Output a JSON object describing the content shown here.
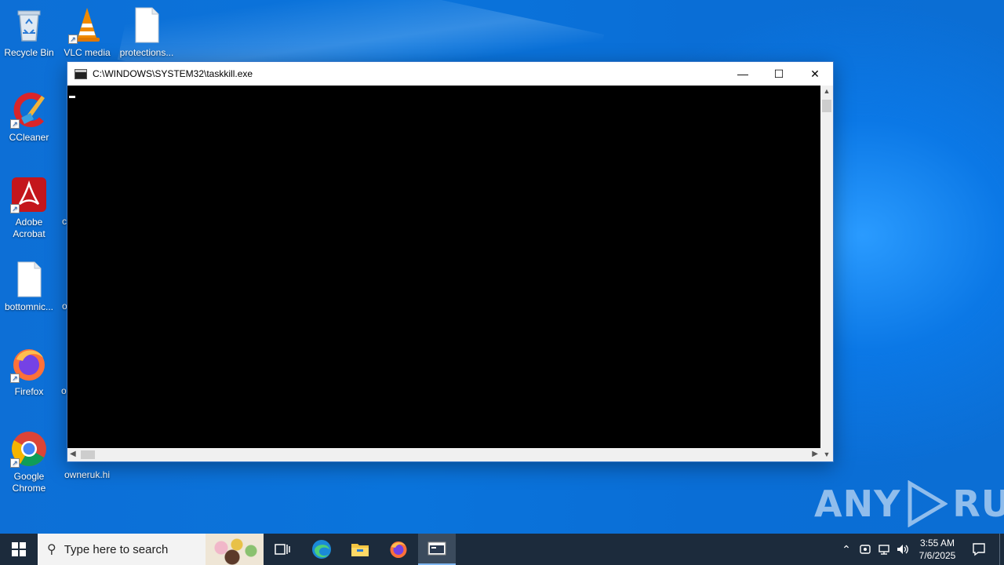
{
  "desktop": {
    "icons": [
      {
        "label": "Recycle Bin"
      },
      {
        "label": "VLC media"
      },
      {
        "label": "protections..."
      },
      {
        "label": "CCleaner"
      },
      {
        "label": "Adobe Acrobat"
      },
      {
        "label": "bottomnic..."
      },
      {
        "label": "Firefox"
      },
      {
        "label": "Google Chrome"
      },
      {
        "label": "owneruk.hi"
      }
    ],
    "partial_labels": [
      "c",
      "o",
      "o"
    ]
  },
  "window": {
    "title": "C:\\WINDOWS\\SYSTEM32\\taskkill.exe",
    "minimize_glyph": "—",
    "maximize_glyph": "☐",
    "close_glyph": "✕"
  },
  "watermark": {
    "left": "ANY",
    "right": "RUN"
  },
  "taskbar": {
    "search_placeholder": "Type here to search",
    "time": "3:55 AM",
    "date": "7/6/2025"
  },
  "colors": {
    "desktop_blue": "#0a74dc",
    "taskbar": "#1c2b3c",
    "console_bg": "#000000"
  }
}
